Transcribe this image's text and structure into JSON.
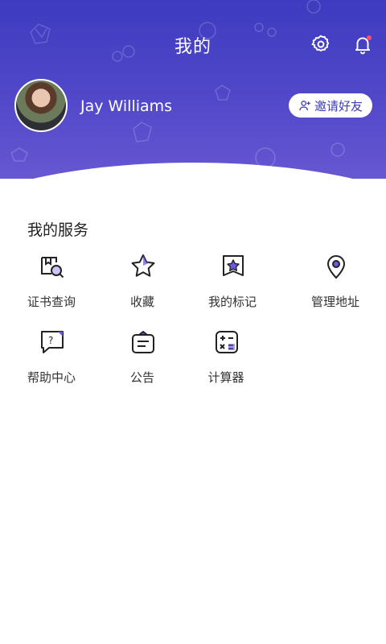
{
  "header": {
    "title": "我的",
    "icons": {
      "settings": "gear-icon",
      "notifications": "bell-icon"
    },
    "colors": {
      "gradient_top": "#3e3bc0",
      "gradient_bottom": "#6757d2",
      "badge": "#ff4d6a"
    }
  },
  "profile": {
    "name": "Jay Williams",
    "invite_label": "邀请好友"
  },
  "services": {
    "title": "我的服务",
    "items": [
      {
        "label": "证书查询",
        "icon": "certificate-search-icon"
      },
      {
        "label": "收藏",
        "icon": "star-icon"
      },
      {
        "label": "我的标记",
        "icon": "bookmark-star-icon"
      },
      {
        "label": "管理地址",
        "icon": "location-pin-icon"
      },
      {
        "label": "帮助中心",
        "icon": "help-chat-icon"
      },
      {
        "label": "公告",
        "icon": "announcement-icon"
      },
      {
        "label": "计算器",
        "icon": "calculator-icon"
      }
    ],
    "accent_color": "#6a5ce0"
  }
}
